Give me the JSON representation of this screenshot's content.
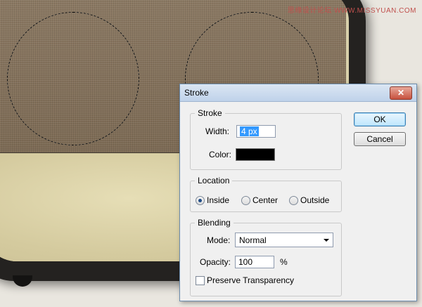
{
  "watermark": "思缘设计论坛 WWW.MISSYUAN.COM",
  "dialog": {
    "title": "Stroke",
    "close_glyph": "✕",
    "stroke_group": {
      "legend": "Stroke",
      "width_label": "Width:",
      "width_value": "4 px",
      "color_label": "Color:",
      "color_value": "#000000"
    },
    "location_group": {
      "legend": "Location",
      "options": [
        "Inside",
        "Center",
        "Outside"
      ],
      "selected": "Inside"
    },
    "blending_group": {
      "legend": "Blending",
      "mode_label": "Mode:",
      "mode_value": "Normal",
      "opacity_label": "Opacity:",
      "opacity_value": "100",
      "opacity_unit": "%",
      "preserve_label": "Preserve Transparency",
      "preserve_checked": false
    },
    "buttons": {
      "ok": "OK",
      "cancel": "Cancel"
    }
  }
}
